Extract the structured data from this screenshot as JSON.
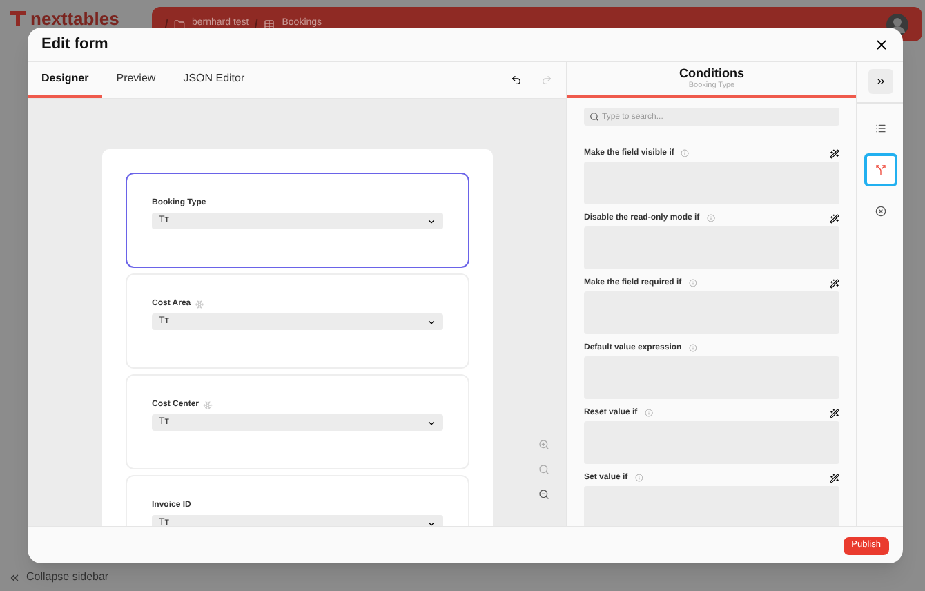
{
  "background": {
    "logo": "nexttables",
    "breadcrumb": [
      "bernhard test",
      "Bookings"
    ],
    "collapse": "Collapse sidebar"
  },
  "modal": {
    "title": "Edit form",
    "tabs": [
      {
        "label": "Designer",
        "selected": true
      },
      {
        "label": "Preview",
        "selected": false
      },
      {
        "label": "JSON Editor",
        "selected": false
      }
    ],
    "fields": [
      {
        "label": "Booking Type",
        "value": "Tт",
        "selected": true,
        "frozen": false
      },
      {
        "label": "Cost Area",
        "value": "Tт",
        "selected": false,
        "frozen": true
      },
      {
        "label": "Cost Center",
        "value": "Tт",
        "selected": false,
        "frozen": true
      },
      {
        "label": "Invoice ID",
        "value": "Tт",
        "selected": false,
        "frozen": false
      }
    ],
    "conditions": {
      "title": "Conditions",
      "subtitle": "Booking Type",
      "search": {
        "placeholder": "Type to search..."
      },
      "items": [
        {
          "label": "Make the field visible if",
          "builder": true
        },
        {
          "label": "Disable the read-only mode if",
          "builder": true
        },
        {
          "label": "Make the field required if",
          "builder": true
        },
        {
          "label": "Default value expression",
          "builder": false
        },
        {
          "label": "Reset value if",
          "builder": true
        },
        {
          "label": "Set value if",
          "builder": true
        }
      ]
    },
    "rail": [
      {
        "kind": "list",
        "selected": false
      },
      {
        "kind": "branch",
        "selected": true
      },
      {
        "kind": "clear",
        "selected": false
      }
    ],
    "publish": "Publish"
  }
}
